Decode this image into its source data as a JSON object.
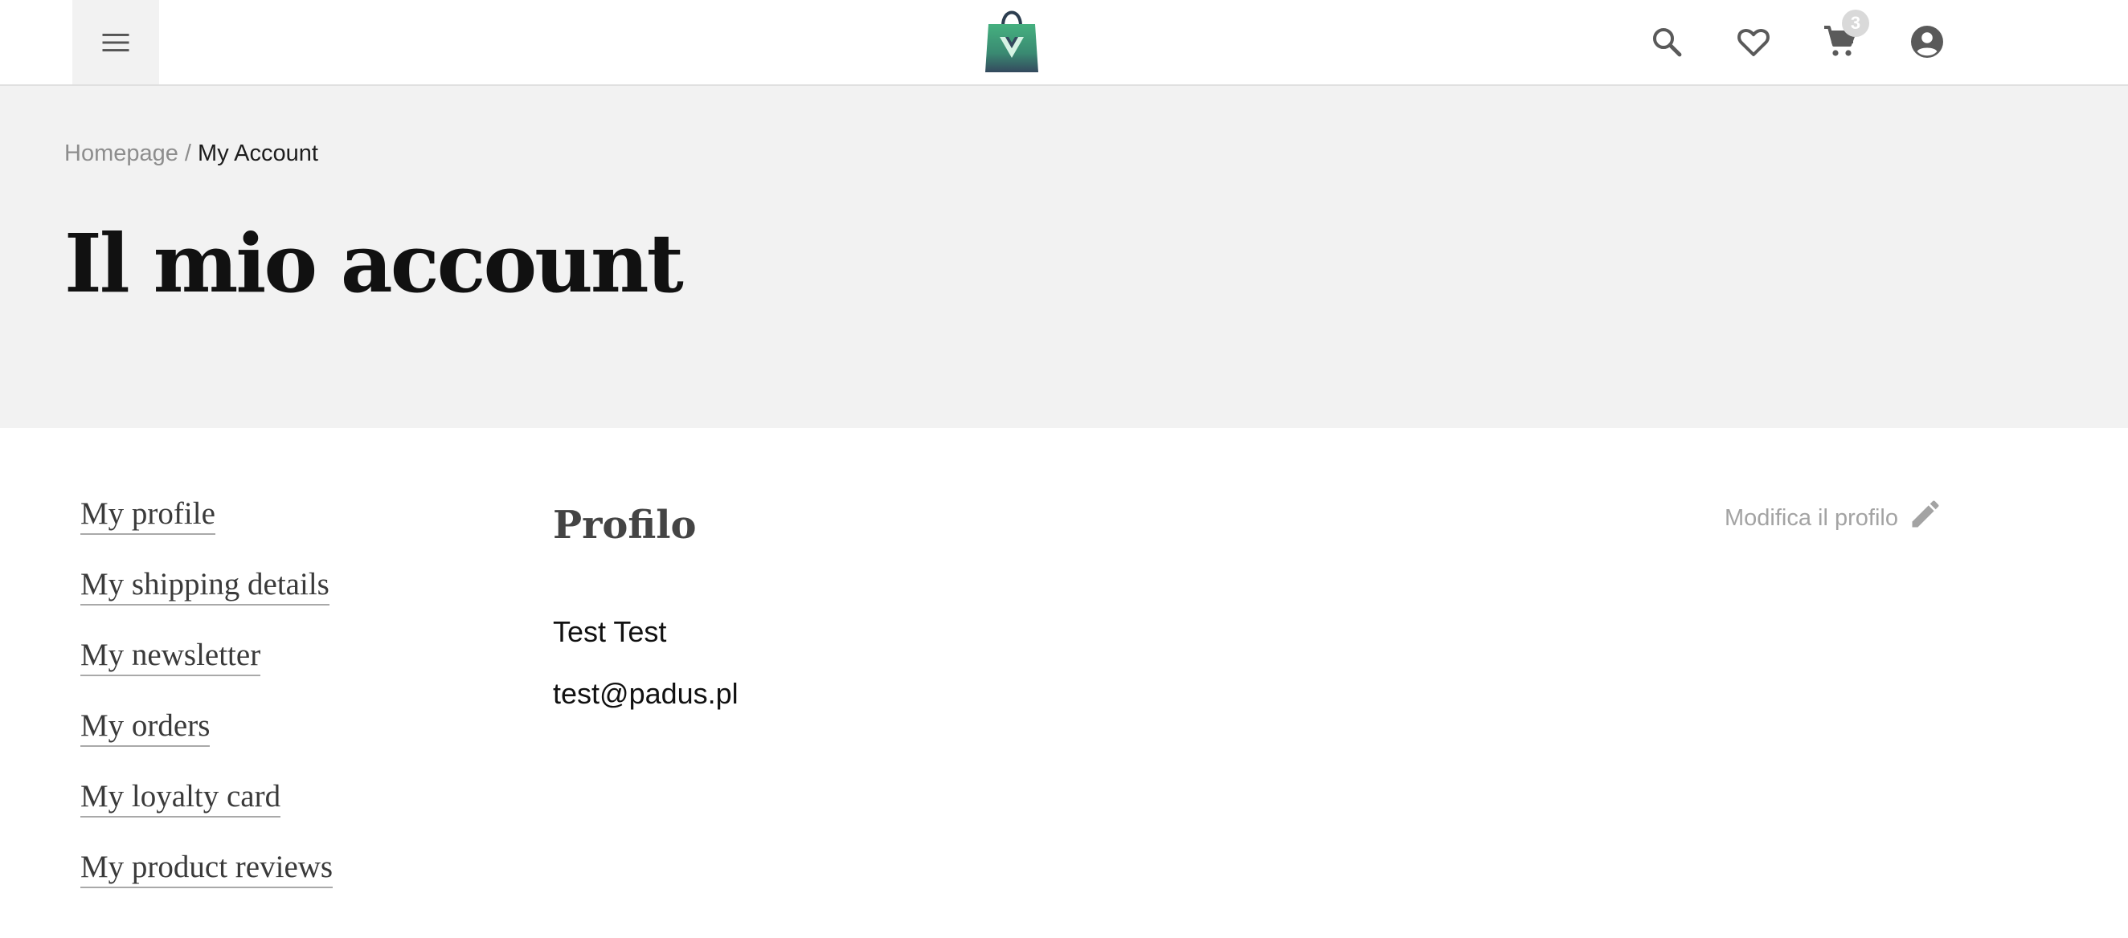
{
  "header": {
    "menu_icon": "hamburger-menu-icon",
    "logo_icon": "shopping-bag-logo",
    "icons": [
      "search-icon",
      "heart-icon",
      "cart-icon",
      "account-circle-icon"
    ],
    "cart_count": "3"
  },
  "breadcrumb": {
    "home": "Homepage",
    "separator": " / ",
    "current": "My Account"
  },
  "page_title": "Il mio account",
  "sidebar": {
    "items": [
      {
        "label": "My profile"
      },
      {
        "label": "My shipping details"
      },
      {
        "label": "My newsletter"
      },
      {
        "label": "My orders"
      },
      {
        "label": "My loyalty card"
      },
      {
        "label": "My product reviews"
      }
    ]
  },
  "profile": {
    "title": "Profilo",
    "edit_label": "Modifica il profilo",
    "edit_icon": "pencil-icon",
    "name": "Test Test",
    "email": "test@padus.pl"
  },
  "colors": {
    "hero_background": "#f2f2f2",
    "logo_green": "#3fa37a",
    "logo_dark": "#34495e",
    "icon_gray": "#5a5a5a"
  }
}
